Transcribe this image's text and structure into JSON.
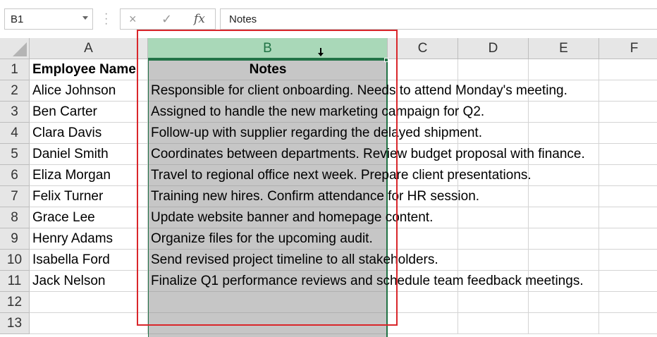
{
  "formula_bar": {
    "name_box": "B1",
    "cancel_icon": "×",
    "enter_icon": "✓",
    "function_icon": "fx",
    "formula_value": "Notes"
  },
  "columns": [
    {
      "key": "row",
      "label": ""
    },
    {
      "key": "A",
      "label": "A"
    },
    {
      "key": "B",
      "label": "B"
    },
    {
      "key": "C",
      "label": "C"
    },
    {
      "key": "D",
      "label": "D"
    },
    {
      "key": "E",
      "label": "E"
    },
    {
      "key": "F",
      "label": "F"
    }
  ],
  "rows": [
    {
      "num": "1",
      "A": "Employee Name",
      "B": "Notes"
    },
    {
      "num": "2",
      "A": "Alice Johnson",
      "B": "Responsible for client onboarding. Needs to attend Monday's meeting."
    },
    {
      "num": "3",
      "A": "Ben Carter",
      "B": "Assigned to handle the new marketing campaign for Q2."
    },
    {
      "num": "4",
      "A": "Clara Davis",
      "B": "Follow-up with supplier regarding the delayed shipment."
    },
    {
      "num": "5",
      "A": "Daniel Smith",
      "B": "Coordinates between departments. Review budget proposal with finance."
    },
    {
      "num": "6",
      "A": "Eliza Morgan",
      "B": "Travel to regional office next week. Prepare client presentations."
    },
    {
      "num": "7",
      "A": "Felix Turner",
      "B": "Training new hires. Confirm attendance for HR session."
    },
    {
      "num": "8",
      "A": "Grace Lee",
      "B": "Update website banner and homepage content."
    },
    {
      "num": "9",
      "A": "Henry Adams",
      "B": "Organize files for the upcoming audit."
    },
    {
      "num": "10",
      "A": "Isabella Ford",
      "B": "Send revised project timeline to all stakeholders."
    },
    {
      "num": "11",
      "A": "Jack Nelson",
      "B": "Finalize Q1 performance reviews and schedule team feedback meetings."
    },
    {
      "num": "12",
      "A": "",
      "B": ""
    },
    {
      "num": "13",
      "A": "",
      "B": ""
    }
  ],
  "colors": {
    "selection_green": "#217346",
    "header_selected_bg": "#a9d8b8",
    "selected_column_bg": "#c6c6c6",
    "highlight_box": "#d9262b"
  }
}
